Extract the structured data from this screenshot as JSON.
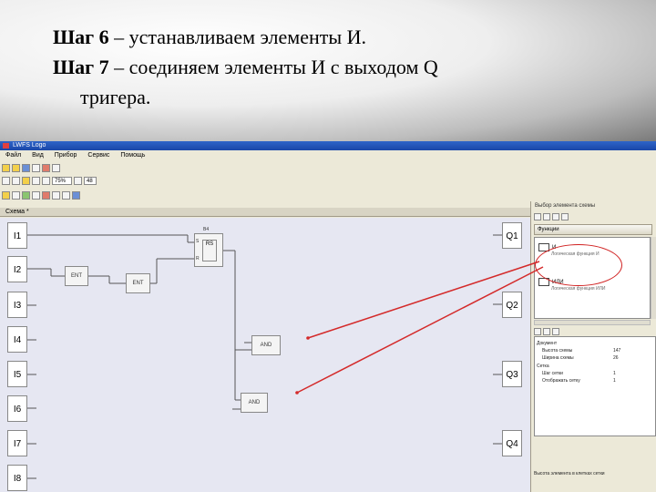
{
  "slide": {
    "line1_step": "Шаг 6",
    "line1_text": " – устанавливаем элементы И.",
    "line2_step": "Шаг 7",
    "line2_text": " – соединяем элементы И с выходом Q",
    "line3_text": "тригера."
  },
  "app": {
    "title": "LWFS Logo",
    "menu": [
      "Файл",
      "Вид",
      "Прибор",
      "Сервис",
      "Помощь"
    ],
    "zoom": "75%",
    "zoom2": "48",
    "tab": "Схема *"
  },
  "diagram": {
    "inputs": [
      "I1",
      "I2",
      "I3",
      "I4",
      "I5",
      "I6",
      "I7",
      "I8"
    ],
    "outputs": [
      "Q1",
      "Q2",
      "Q3",
      "Q4"
    ],
    "rs_block": {
      "label": "B4",
      "set": "S",
      "mid": "RS",
      "reset": "R"
    },
    "gates": {
      "g1": "ENT",
      "g2": "ENT",
      "and1": "AND",
      "and2": "AND"
    }
  },
  "panel": {
    "title": "Выбор элемента схемы",
    "group": "Функции",
    "items": [
      {
        "name": "И",
        "sub": "Логическая функция И"
      },
      {
        "name": "ИЛИ",
        "sub": "Логическая функция ИЛИ"
      }
    ],
    "props": [
      {
        "label": "Документ",
        "value": ""
      },
      {
        "label": "Высота схемы",
        "value": "147"
      },
      {
        "label": "Ширина схемы",
        "value": "26"
      },
      {
        "label": "Сетка",
        "value": ""
      },
      {
        "label": "Шаг сетки",
        "value": "1"
      },
      {
        "label": "Отображать сетку",
        "value": "1"
      }
    ],
    "desc": "Высота элемента в клетках сетки"
  },
  "colors": {
    "arrow": "#d42a2a",
    "canvas": "#e6e7f2"
  }
}
